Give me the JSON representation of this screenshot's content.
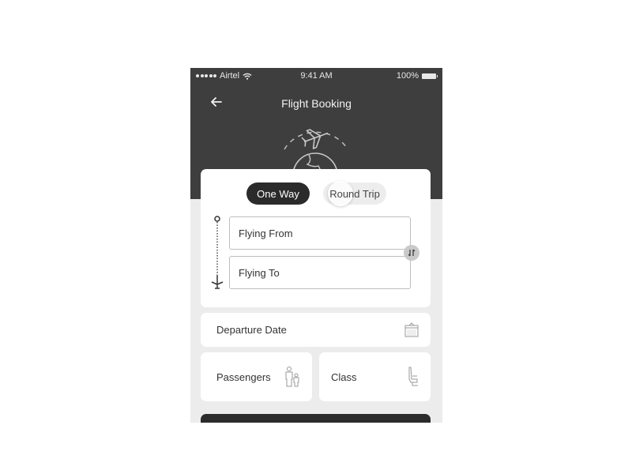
{
  "status_bar": {
    "carrier": "Airtel",
    "time": "9:41 AM",
    "battery": "100%"
  },
  "header": {
    "title": "Flight Booking",
    "back_icon": "arrow-left-icon",
    "hero_icon": "plane-over-globe-icon"
  },
  "trip_type": {
    "options": [
      "One Way",
      "Round Trip"
    ],
    "selected": "One Way"
  },
  "route": {
    "from_placeholder": "Flying From",
    "to_placeholder": "Flying To",
    "swap_icon": "swap-vertical-icon"
  },
  "departure": {
    "label": "Departure Date",
    "icon": "calendar-icon"
  },
  "passengers": {
    "label": "Passengers",
    "icon": "family-icon"
  },
  "class": {
    "label": "Class",
    "icon": "seat-icon"
  },
  "colors": {
    "header_bg": "#3e3e3f",
    "accent_dark": "#2b2b2b",
    "screen_bg": "#ececec"
  }
}
